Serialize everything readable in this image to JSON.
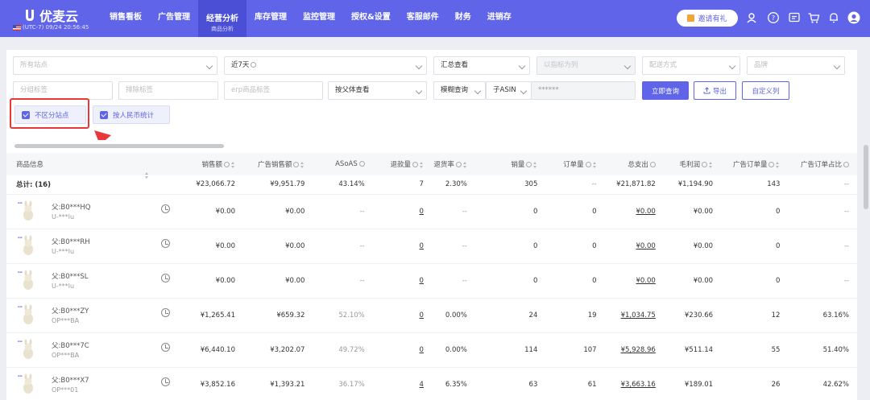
{
  "app": {
    "logo_text": "优麦云",
    "clock": "(UTC-7) 09/24 20:56:45"
  },
  "nav": {
    "items": [
      "销售看板",
      "广告管理",
      "经营分析",
      "库存管理",
      "监控管理",
      "授权&设置",
      "客服邮件",
      "财务",
      "进销存"
    ],
    "active_sub": "商品分析",
    "invite_label": "邀请有礼"
  },
  "filters": {
    "site": "所有站点",
    "range": "近7天",
    "view": "汇总查看",
    "indicator": "以指标为列",
    "delivery": "配送方式",
    "brand": "品牌",
    "tag_group": "分组标签",
    "exclude_tag": "排除标签",
    "erp_tag": "erp商品标签",
    "parent_view": "按父体查看",
    "fuzzy": "模糊查询",
    "asin_type": "子ASIN",
    "asin_value": "******",
    "query_btn": "立即查询",
    "export_btn": "导出",
    "custom_btn": "自定义列",
    "chk_site": "不区分站点",
    "chk_rmb": "按人民币统计"
  },
  "table": {
    "headers": [
      "商品信息",
      "销售额",
      "广告销售额",
      "ASoAS",
      "退款量",
      "退货率",
      "销量",
      "订单量",
      "总支出",
      "毛利润",
      "广告订单量",
      "广告订单占比"
    ],
    "total": [
      "总计: (16)",
      "¥23,066.72",
      "¥9,951.79",
      "43.14%",
      "7",
      "2.30%",
      "305",
      "--",
      "¥21,871.82",
      "¥1,194.90",
      "143",
      "--"
    ],
    "rows": [
      {
        "name": "父:B0***HQ",
        "id": "U-***lu",
        "sales": "¥0.00",
        "ad_sales": "¥0.00",
        "asoas": "--",
        "refund": "0",
        "return_rate": "--",
        "units": "0",
        "orders": "0",
        "spend": "¥0.00",
        "profit": "¥0.00",
        "ad_orders": "0",
        "ad_ratio": "--"
      },
      {
        "name": "父:B0***RH",
        "id": "U-***lu",
        "sales": "¥0.00",
        "ad_sales": "¥0.00",
        "asoas": "--",
        "refund": "0",
        "return_rate": "--",
        "units": "0",
        "orders": "0",
        "spend": "¥0.00",
        "profit": "¥0.00",
        "ad_orders": "0",
        "ad_ratio": "--"
      },
      {
        "name": "父:B0***SL",
        "id": "U-***lu",
        "sales": "¥0.00",
        "ad_sales": "¥0.00",
        "asoas": "--",
        "refund": "0",
        "return_rate": "--",
        "units": "0",
        "orders": "0",
        "spend": "¥0.00",
        "profit": "¥0.00",
        "ad_orders": "0",
        "ad_ratio": "--"
      },
      {
        "name": "父:B0***ZY",
        "id": "OP***BA",
        "sales": "¥1,265.41",
        "ad_sales": "¥659.32",
        "asoas": "52.10%",
        "refund": "0",
        "return_rate": "0.00%",
        "units": "24",
        "orders": "19",
        "spend": "¥1,034.75",
        "profit": "¥230.66",
        "ad_orders": "12",
        "ad_ratio": "63.16%"
      },
      {
        "name": "父:B0***7C",
        "id": "OP***BA",
        "sales": "¥6,440.10",
        "ad_sales": "¥3,202.07",
        "asoas": "49.72%",
        "refund": "0",
        "return_rate": "0.00%",
        "units": "114",
        "orders": "107",
        "spend": "¥5,928.96",
        "profit": "¥511.14",
        "ad_orders": "55",
        "ad_ratio": "51.40%"
      },
      {
        "name": "父:B0***X7",
        "id": "OP***01",
        "sales": "¥3,852.16",
        "ad_sales": "¥1,393.21",
        "asoas": "36.17%",
        "refund": "4",
        "return_rate": "6.35%",
        "units": "63",
        "orders": "61",
        "spend": "¥3,663.16",
        "profit": "¥189.01",
        "ad_orders": "26",
        "ad_ratio": "42.62%"
      }
    ]
  },
  "colors": {
    "primary": "#5f64e8",
    "highlight": "#e8383a"
  },
  "icons": [
    "logo-icon",
    "flag-icon",
    "gift-icon",
    "user-search-icon",
    "help-icon",
    "message-icon",
    "cart-icon",
    "bell-icon",
    "avatar-icon",
    "trend-icon",
    "upload-icon",
    "check-icon",
    "product-thumbnail-icon"
  ]
}
